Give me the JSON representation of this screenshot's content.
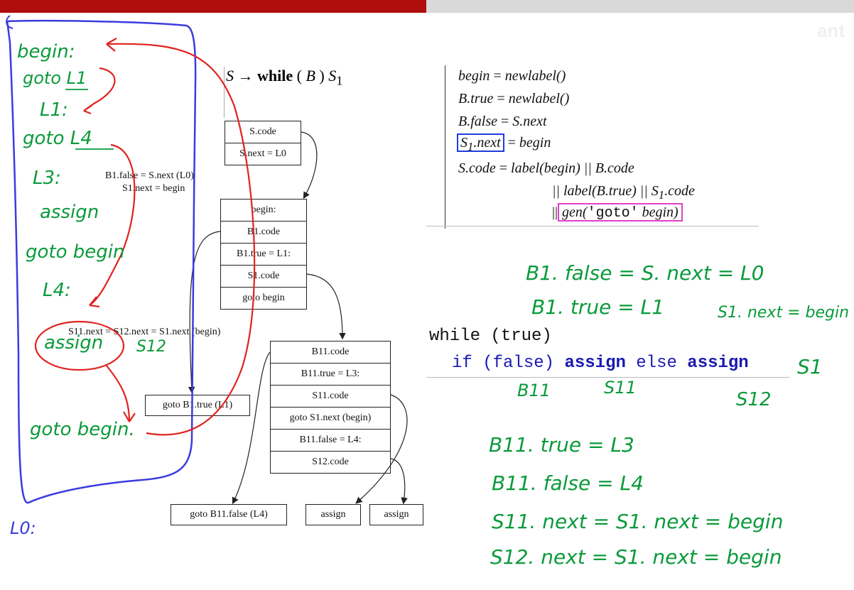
{
  "watermark": "ant",
  "production": {
    "lhs": "S",
    "arrow": "→",
    "keyword": "while",
    "open": "(",
    "cond": "B",
    "close": ")",
    "body": "S",
    "body_sub": "1"
  },
  "diagram": {
    "top_stack": [
      "S.code",
      "S.next = L0"
    ],
    "annot1": "B1.false = S.next (L0)",
    "annot2": "S1.next = begin",
    "loop_stack": [
      "begin:",
      "B1.code",
      "B1.true = L1:",
      "S1.code",
      "goto begin"
    ],
    "annot3": "S11.next = S12.next = S1.next (begin)",
    "inner_stack": [
      "B11.code",
      "B11.true = L3:",
      "S11.code",
      "goto S1.next (begin)",
      "B11.false = L4:",
      "S12.code"
    ],
    "goto_b1": "goto B1.true (L1)",
    "goto_b11": "goto B11.false (L4)",
    "assign1": "assign",
    "assign2": "assign"
  },
  "rules": {
    "l1a": "begin",
    "l1b": "=",
    "l1c": "newlabel()",
    "l2a": "B.true",
    "l2b": "=",
    "l2c": "newlabel()",
    "l3a": "B.false",
    "l3b": "=",
    "l3c": "S.next",
    "l4a": "S",
    "l4sub": "1",
    "l4a2": ".next",
    "l4b": "=",
    "l4c": "begin",
    "l5a": "S.code",
    "l5b": "=",
    "l5c": "label(begin) || B.code",
    "l6": "|| label(B.true) || S",
    "l6sub": "1",
    "l6tail": ".code",
    "l7a": "||",
    "l7b": "gen(",
    "l7c": "'goto'",
    "l7d": "begin)"
  },
  "code": {
    "line1": "while (true)",
    "if": "if",
    "cond": "(false)",
    "assign1": "assign",
    "else": "else",
    "assign2": "assign"
  },
  "handwriting": {
    "left": [
      "begin:",
      "goto L1",
      "L1:",
      "goto L4",
      "L3:",
      "assign",
      "goto begin",
      "L4:",
      "assign",
      "S12",
      "goto begin.",
      "L0:"
    ],
    "right_top": [
      "B1. false = S. next = L0",
      "B1. true = L1",
      "S1. next = begin"
    ],
    "code_marks": [
      "S1",
      "B11",
      "S11",
      "S12"
    ],
    "right_bottom": [
      "B11. true = L3",
      "B11. false = L4",
      "S11. next = S1. next = begin",
      "S12. next = S1. next = begin"
    ]
  },
  "colors": {
    "red_bar": "#b00d0d",
    "ink_green": "#0a9a3a",
    "ink_red": "#e0231f",
    "ink_blue": "#3b3be0",
    "box_blue": "#1f3fd6",
    "box_pink": "#e040c8"
  }
}
